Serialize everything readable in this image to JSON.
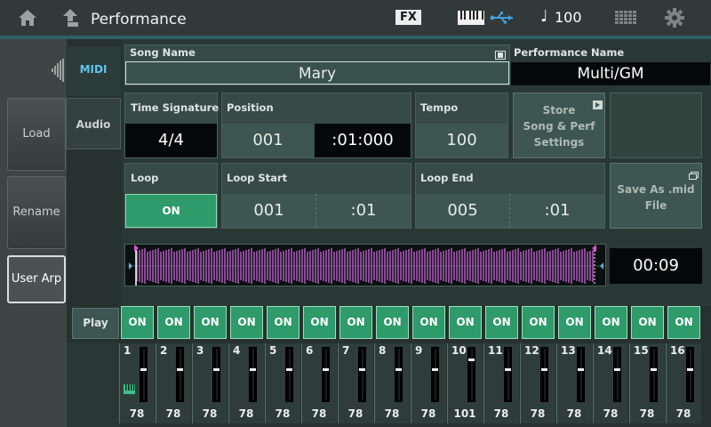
{
  "header": {
    "title": "Performance",
    "fx_label": "FX",
    "tempo_icon": "♩",
    "tempo": "100"
  },
  "side_buttons": {
    "load": "Load",
    "rename": "Rename",
    "user_arp": "User Arp"
  },
  "tabs": {
    "midi": "MIDI",
    "audio": "Audio"
  },
  "song": {
    "label": "Song Name",
    "value": "Mary"
  },
  "performance": {
    "label": "Performance Name",
    "value": "Multi/GM"
  },
  "time_signature": {
    "label": "Time Signature",
    "value": "4/4"
  },
  "position": {
    "label": "Position",
    "measure": "001",
    "beat_clock": ":01:000"
  },
  "tempo_box": {
    "label": "Tempo",
    "value": "100"
  },
  "store": {
    "line1": "Store",
    "line2": "Song & Perf",
    "line3": "Settings"
  },
  "loop": {
    "label": "Loop",
    "state": "ON"
  },
  "loop_start": {
    "label": "Loop Start",
    "measure": "001",
    "beat": ":01"
  },
  "loop_end": {
    "label": "Loop End",
    "measure": "005",
    "beat": ":01"
  },
  "save_mid": {
    "line1": "Save As .mid",
    "line2": "File"
  },
  "time_display": "00:09",
  "play": {
    "label": "Play"
  },
  "channels": [
    {
      "num": "1",
      "state": "ON",
      "volume": "78"
    },
    {
      "num": "2",
      "state": "ON",
      "volume": "78"
    },
    {
      "num": "3",
      "state": "ON",
      "volume": "78"
    },
    {
      "num": "4",
      "state": "ON",
      "volume": "78"
    },
    {
      "num": "5",
      "state": "ON",
      "volume": "78"
    },
    {
      "num": "6",
      "state": "ON",
      "volume": "78"
    },
    {
      "num": "7",
      "state": "ON",
      "volume": "78"
    },
    {
      "num": "8",
      "state": "ON",
      "volume": "78"
    },
    {
      "num": "9",
      "state": "ON",
      "volume": "78"
    },
    {
      "num": "10",
      "state": "ON",
      "volume": "101"
    },
    {
      "num": "11",
      "state": "ON",
      "volume": "78"
    },
    {
      "num": "12",
      "state": "ON",
      "volume": "78"
    },
    {
      "num": "13",
      "state": "ON",
      "volume": "78"
    },
    {
      "num": "14",
      "state": "ON",
      "volume": "78"
    },
    {
      "num": "15",
      "state": "ON",
      "volume": "78"
    },
    {
      "num": "16",
      "state": "ON",
      "volume": "78"
    }
  ],
  "colors": {
    "on_green": "#2f9a6a",
    "midi_tab": "#5fc5f0",
    "waveform": "#c060d0"
  },
  "icons": [
    "home-icon",
    "up-arrow-icon",
    "keyboard-icon",
    "usb-icon",
    "grid-icon",
    "gear-icon"
  ]
}
